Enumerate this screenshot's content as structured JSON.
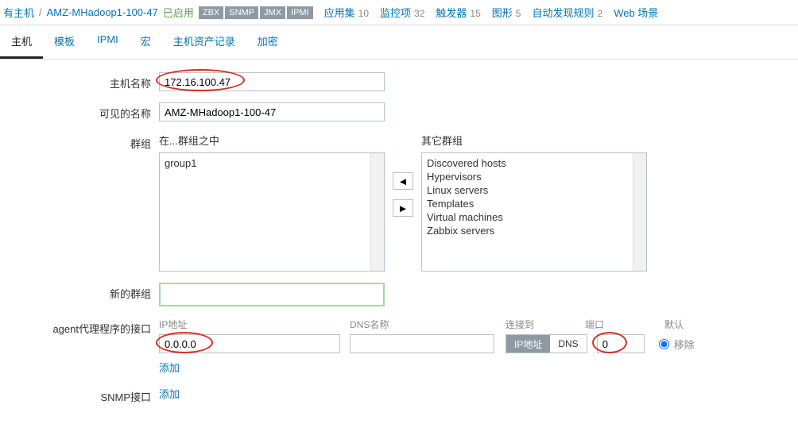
{
  "header": {
    "all_hosts_label": "有主机",
    "host_name_link": "AMZ-MHadoop1-100-47",
    "status_enabled": "已启用",
    "badges": [
      "ZBX",
      "SNMP",
      "JMX",
      "IPMI"
    ],
    "navlinks": [
      {
        "label": "应用集",
        "count": "10"
      },
      {
        "label": "监控项",
        "count": "32"
      },
      {
        "label": "触发器",
        "count": "15"
      },
      {
        "label": "图形",
        "count": "5"
      },
      {
        "label": "自动发现规则",
        "count": "2"
      },
      {
        "label": "Web 场景",
        "count": ""
      }
    ]
  },
  "tabs": {
    "items": [
      "主机",
      "模板",
      "IPMI",
      "宏",
      "主机资产记录",
      "加密"
    ],
    "active": "主机"
  },
  "form": {
    "hostname_label": "主机名称",
    "hostname_value": "172.16.100.47",
    "visible_label": "可见的名称",
    "visible_value": "AMZ-MHadoop1-100-47",
    "groups_label": "群组",
    "in_groups_label": "在...群组之中",
    "other_groups_label": "其它群组",
    "left_groups": [
      "group1"
    ],
    "right_groups": [
      "Discovered hosts",
      "Hypervisors",
      "Linux servers",
      "Templates",
      "Virtual machines",
      "Zabbix servers"
    ],
    "move_left_icon": "◄",
    "move_right_icon": "►",
    "new_group_label": "新的群组",
    "new_group_value": "",
    "iface_label": "agent代理程序的接口",
    "iface_headers": {
      "ip": "IP地址",
      "dns": "DNS名称",
      "connect": "连接到",
      "port": "端口",
      "default": "默认"
    },
    "iface_ip": "0.0.0.0",
    "iface_dns": "",
    "iface_connect_ip": "IP地址",
    "iface_connect_dns": "DNS",
    "iface_port": "0",
    "iface_remove": "移除",
    "iface_add": "添加",
    "snmp_label": "SNMP接口",
    "snmp_add": "添加"
  }
}
